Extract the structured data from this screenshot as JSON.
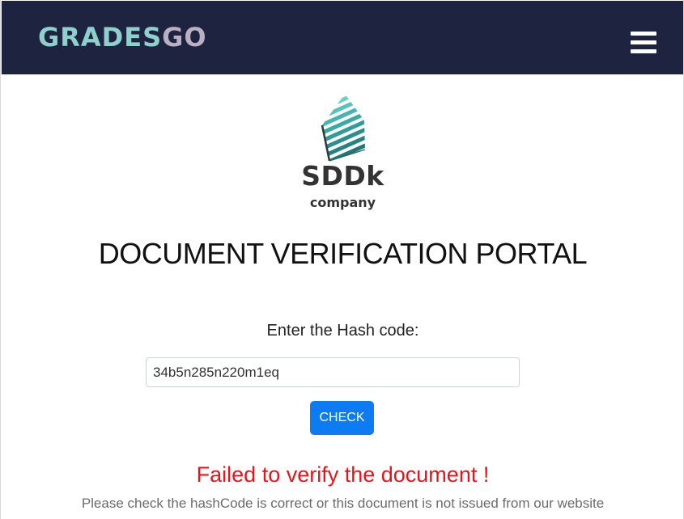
{
  "navbar": {
    "brand_part1": "GRADES",
    "brand_part2": "GO",
    "brand_color_1": "#8fd0cf",
    "brand_color_2": "#b9b0c4",
    "background": "#1e2340",
    "menu_icon": "hamburger-menu-icon"
  },
  "logo": {
    "name": "SDDk",
    "subtitle": "company",
    "mark_icon": "striped-teal-crystal-logo",
    "mark_color": "#3fb8b0"
  },
  "page": {
    "title": "DOCUMENT VERIFICATION PORTAL"
  },
  "form": {
    "label": "Enter the Hash code:",
    "hash_value": "34b5n285n220m1eq",
    "check_label": "CHECK",
    "button_color": "#0d7cf2"
  },
  "result": {
    "title": "Failed to verify the document !",
    "detail": "Please check the hashCode is correct or this document is not issued from our website",
    "title_color": "#e8141b"
  }
}
